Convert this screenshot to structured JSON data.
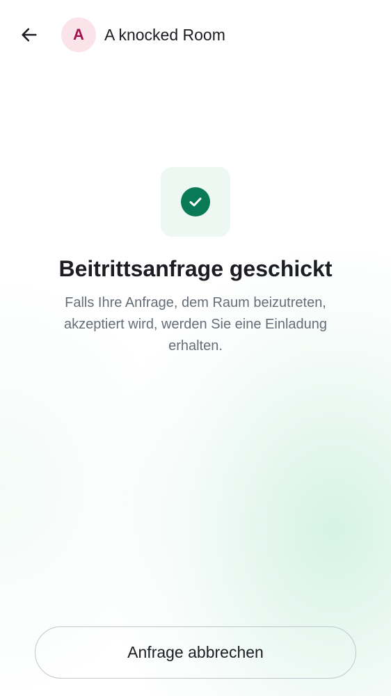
{
  "header": {
    "back_icon": "arrow-left-icon",
    "avatar_letter": "A",
    "room_name": "A knocked Room"
  },
  "status": {
    "icon": "check-circle-icon",
    "title": "Beitrittsanfrage geschickt",
    "description": "Falls Ihre Anfrage, dem Raum beizutreten, akzeptiert wird, werden Sie eine Einladung erhalten."
  },
  "actions": {
    "cancel_label": "Anfrage abbrechen"
  },
  "colors": {
    "accent": "#0a7a56",
    "avatar_bg": "#fbe3ea",
    "avatar_text": "#a2124f"
  }
}
